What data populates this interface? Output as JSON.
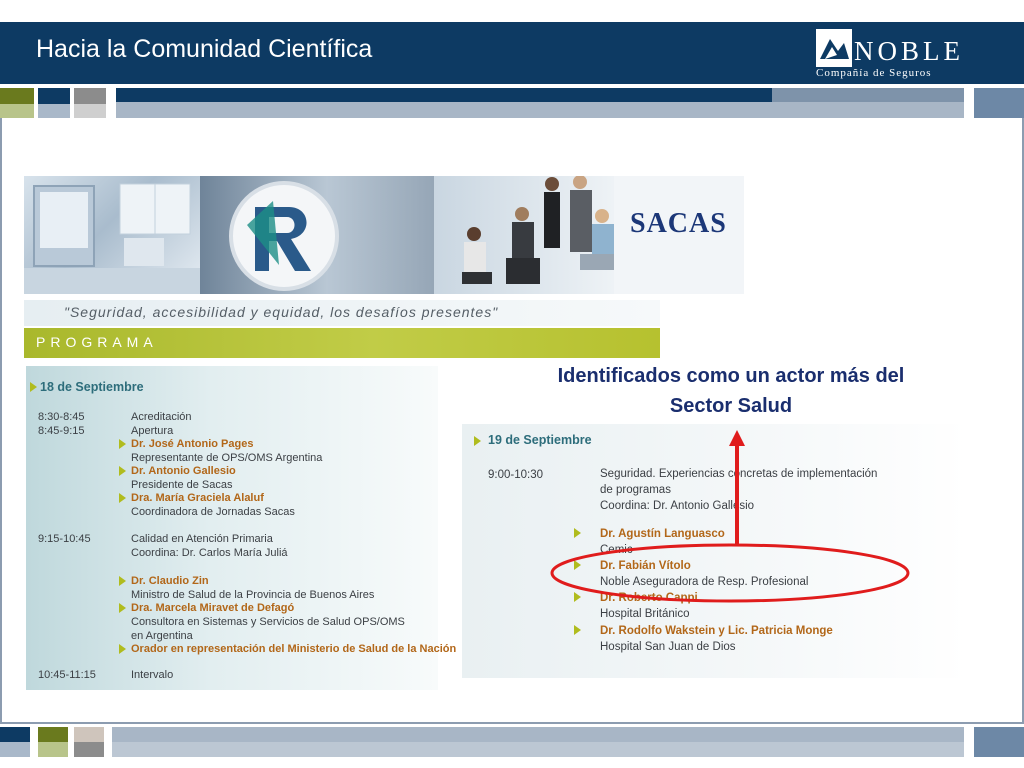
{
  "header": {
    "title": "Hacia la Comunidad Científica",
    "logo_word": "NOBLE",
    "logo_sub": "Compañía de Seguros"
  },
  "banner": {
    "brand": "SACAS"
  },
  "program": {
    "motto": "\"Seguridad, accesibilidad y equidad, los desafíos presentes\"",
    "label": "PROGRAMA",
    "day1": {
      "date": "18 de Septiembre",
      "lines": [
        {
          "time": "8:30-8:45",
          "text": "Acreditación",
          "is_name": false
        },
        {
          "time": "8:45-9:15",
          "text": "Apertura",
          "is_name": false
        },
        {
          "time": "",
          "text": "Dr. José Antonio Pages",
          "is_name": true
        },
        {
          "time": "",
          "text": "Representante de OPS/OMS Argentina",
          "is_name": false
        },
        {
          "time": "",
          "text": "Dr. Antonio Gallesio",
          "is_name": true
        },
        {
          "time": "",
          "text": "Presidente de Sacas",
          "is_name": false
        },
        {
          "time": "",
          "text": "Dra. María Graciela Alaluf",
          "is_name": true
        },
        {
          "time": "",
          "text": "Coordinadora de Jornadas Sacas",
          "is_name": false
        },
        {
          "time": "9:15-10:45",
          "text": "Calidad en Atención Primaria",
          "is_name": false
        },
        {
          "time": "",
          "text": "Coordina: Dr. Carlos María Juliá",
          "is_name": false
        },
        {
          "time": "",
          "text": "Dr. Claudio Zin",
          "is_name": true
        },
        {
          "time": "",
          "text": "Ministro de Salud de la Provincia de Buenos Aires",
          "is_name": false
        },
        {
          "time": "",
          "text": "Dra. Marcela Miravet de Defagó",
          "is_name": true
        },
        {
          "time": "",
          "text": "Consultora en Sistemas y Servicios de Salud OPS/OMS",
          "is_name": false
        },
        {
          "time": "",
          "text": "en Argentina",
          "is_name": false
        },
        {
          "time": "",
          "text": "Orador en representación del Ministerio de Salud de la Nación",
          "is_name": true
        },
        {
          "time": "10:45-11:15",
          "text": "Intervalo",
          "is_name": false
        }
      ]
    },
    "day2": {
      "date": "19 de Septiembre",
      "lines": [
        {
          "time": "9:00-10:30",
          "text": "Seguridad. Experiencias concretas de implementación",
          "is_name": false
        },
        {
          "time": "",
          "text": "de programas",
          "is_name": false
        },
        {
          "time": "",
          "text": "Coordina: Dr. Antonio Gallesio",
          "is_name": false
        },
        {
          "time": "",
          "text": "Dr. Agustín Languasco",
          "is_name": true
        },
        {
          "time": "",
          "text": "Cemic",
          "is_name": false
        },
        {
          "time": "",
          "text": "Dr. Fabián Vítolo",
          "is_name": true
        },
        {
          "time": "",
          "text": "Noble Aseguradora de Resp. Profesional",
          "is_name": false
        },
        {
          "time": "",
          "text": "Dr. Roberto Cappi",
          "is_name": true
        },
        {
          "time": "",
          "text": "Hospital Británico",
          "is_name": false
        },
        {
          "time": "",
          "text": "Dr. Rodolfo Wakstein y Lic. Patricia Monge",
          "is_name": true
        },
        {
          "time": "",
          "text": "Hospital San Juan de Dios",
          "is_name": false
        }
      ]
    }
  },
  "callout": {
    "line1": "Identificados como un actor más del",
    "line2": "Sector Salud"
  },
  "colors": {
    "header_navy": "#0d3a63",
    "program_green": "#b3bf2e",
    "name_orange": "#b26719",
    "callout_navy": "#1a2e6e",
    "annotation_red": "#e01c1c"
  }
}
